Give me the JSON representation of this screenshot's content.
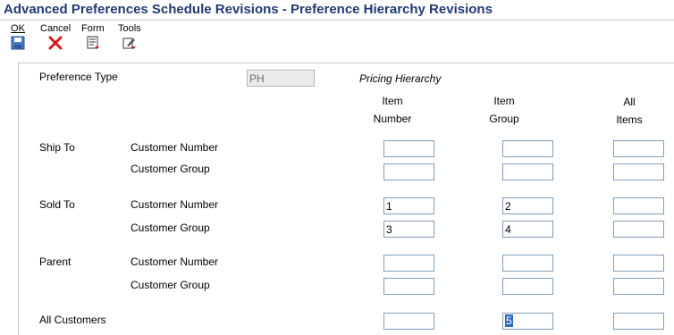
{
  "window": {
    "title": "Advanced Preferences Schedule Revisions - Preference Hierarchy Revisions"
  },
  "toolbar": {
    "ok_label": "OK",
    "cancel_label": "Cancel",
    "form_label": "Form",
    "tools_label": "Tools"
  },
  "form": {
    "preference_type_label": "Preference Type",
    "preference_type_value": "PH",
    "preference_type_description": "Pricing Hierarchy",
    "columns": {
      "item_number": [
        "Item",
        "Number"
      ],
      "item_group": [
        "Item",
        "Group"
      ],
      "all_items": [
        "All",
        "Items"
      ]
    },
    "rows": {
      "ship_to": {
        "label": "Ship To",
        "customer_number": {
          "label": "Customer Number",
          "item_number": "",
          "item_group": "",
          "all_items": ""
        },
        "customer_group": {
          "label": "Customer Group",
          "item_number": "",
          "item_group": "",
          "all_items": ""
        }
      },
      "sold_to": {
        "label": "Sold To",
        "customer_number": {
          "label": "Customer Number",
          "item_number": "1",
          "item_group": "2",
          "all_items": ""
        },
        "customer_group": {
          "label": "Customer Group",
          "item_number": "3",
          "item_group": "4",
          "all_items": ""
        }
      },
      "parent": {
        "label": "Parent",
        "customer_number": {
          "label": "Customer Number",
          "item_number": "",
          "item_group": "",
          "all_items": ""
        },
        "customer_group": {
          "label": "Customer Group",
          "item_number": "",
          "item_group": "",
          "all_items": ""
        }
      },
      "all_customers": {
        "label": "All Customers",
        "item_number": "",
        "item_group": "5",
        "all_items": ""
      }
    }
  }
}
